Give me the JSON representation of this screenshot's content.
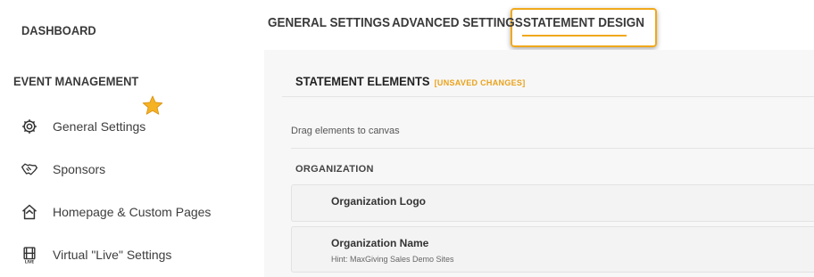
{
  "sidebar": {
    "dashboard_label": "DASHBOARD",
    "section_title": "EVENT MANAGEMENT",
    "items": [
      {
        "label": "General Settings",
        "icon": "gear-icon"
      },
      {
        "label": "Sponsors",
        "icon": "handshake-icon"
      },
      {
        "label": "Homepage & Custom Pages",
        "icon": "home-icon"
      },
      {
        "label": "Virtual \"Live\" Settings",
        "icon": "film-live-icon"
      }
    ]
  },
  "tabs": [
    {
      "label": "GENERAL SETTINGS",
      "active": false
    },
    {
      "label": "ADVANCED SETTINGS",
      "active": false
    },
    {
      "label": "STATEMENT DESIGN",
      "active": true
    }
  ],
  "panel": {
    "title": "STATEMENT ELEMENTS",
    "status": "[UNSAVED CHANGES]",
    "instruction": "Drag elements to canvas",
    "section": "ORGANIZATION",
    "elements": [
      {
        "name": "Organization Logo",
        "hint": ""
      },
      {
        "name": "Organization Name",
        "hint": "Hint: MaxGiving Sales Demo Sites"
      }
    ]
  },
  "colors": {
    "accent": "#f0a81c",
    "star": "#f5b223"
  }
}
